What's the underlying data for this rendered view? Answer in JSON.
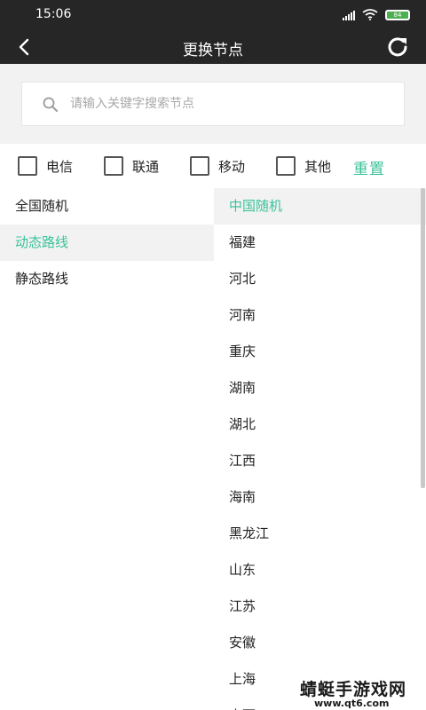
{
  "status_bar": {
    "time": "15:06",
    "battery": "84",
    "icons": [
      "signal-icon",
      "wifi-icon",
      "battery-icon"
    ]
  },
  "app_bar": {
    "title": "更换节点",
    "back_icon": "back-arrow-icon",
    "refresh_icon": "refresh-icon"
  },
  "search": {
    "placeholder": "请输入关键字搜索节点",
    "value": "",
    "icon": "search-icon"
  },
  "filters": {
    "items": [
      {
        "label": "电信",
        "checked": false
      },
      {
        "label": "联通",
        "checked": false
      },
      {
        "label": "移动",
        "checked": false
      },
      {
        "label": "其他",
        "checked": false
      }
    ],
    "reset_label": "重置"
  },
  "left_list": {
    "items": [
      {
        "label": "全国随机"
      },
      {
        "label": "动态路线"
      },
      {
        "label": "静态路线"
      }
    ],
    "selected": "动态路线"
  },
  "right_list": {
    "items": [
      {
        "label": "中国随机"
      },
      {
        "label": "福建"
      },
      {
        "label": "河北"
      },
      {
        "label": "河南"
      },
      {
        "label": "重庆"
      },
      {
        "label": "湖南"
      },
      {
        "label": "湖北"
      },
      {
        "label": "江西"
      },
      {
        "label": "海南"
      },
      {
        "label": "黑龙江"
      },
      {
        "label": "山东"
      },
      {
        "label": "江苏"
      },
      {
        "label": "安徽"
      },
      {
        "label": "上海"
      },
      {
        "label": "山西"
      }
    ],
    "selected": "中国随机"
  },
  "watermark": {
    "text": "蜻蜓手游戏网",
    "url": "www.qt6.com"
  },
  "colors": {
    "accent": "#3ac29a",
    "header_bg": "#262626",
    "panel_bg": "#f2f2f2"
  }
}
